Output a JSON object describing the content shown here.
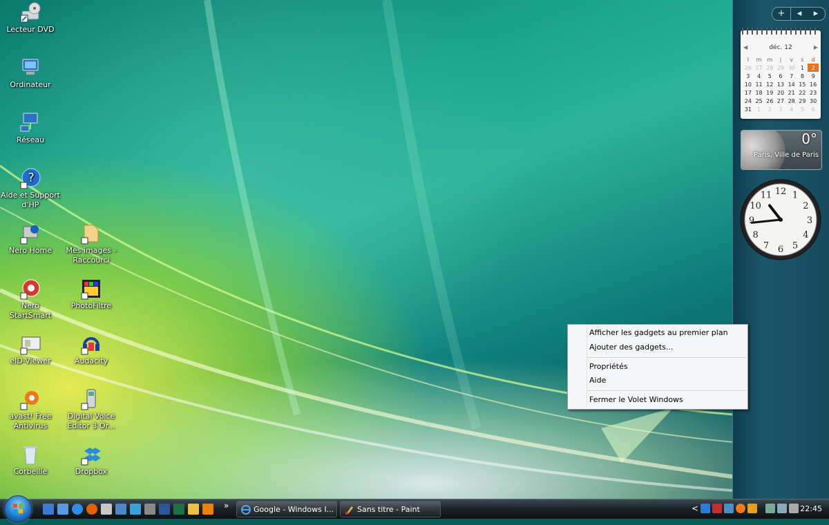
{
  "desktop": {
    "icons": [
      {
        "label": "Lecteur DVD"
      },
      {
        "label": "Ordinateur"
      },
      {
        "label": "Réseau"
      },
      {
        "label": "Aide et Support d'HP"
      },
      {
        "label": "Nero Home"
      },
      {
        "label": "Nero StartSmart"
      },
      {
        "label": "eID-Viewer"
      },
      {
        "label": "avast! Free Antivirus"
      },
      {
        "label": "Corbeille"
      },
      {
        "label": "Mes images - Raccourci"
      },
      {
        "label": "PhotoFiltre"
      },
      {
        "label": "Audacity"
      },
      {
        "label": "Digital Voice Editor 3 Or..."
      },
      {
        "label": "Dropbox"
      }
    ]
  },
  "sidebar": {
    "add_label": "+",
    "prev_label": "◂",
    "next_label": "▸",
    "calendar": {
      "month": "déc. 12",
      "prev": "◀",
      "next": "▶",
      "weekdays": [
        "l",
        "m",
        "m",
        "j",
        "v",
        "s",
        "d"
      ],
      "weeks": [
        [
          "26",
          "27",
          "28",
          "29",
          "30",
          "1",
          "2"
        ],
        [
          "3",
          "4",
          "5",
          "6",
          "7",
          "8",
          "9"
        ],
        [
          "10",
          "11",
          "12",
          "13",
          "14",
          "15",
          "16"
        ],
        [
          "17",
          "18",
          "19",
          "20",
          "21",
          "22",
          "23"
        ],
        [
          "24",
          "25",
          "26",
          "27",
          "28",
          "29",
          "30"
        ],
        [
          "31",
          "1",
          "2",
          "3",
          "4",
          "5",
          "6"
        ]
      ],
      "today": "2"
    },
    "weather": {
      "temperature": "0°",
      "location": "Paris, Ville de Paris"
    },
    "clock": {
      "hours": 10,
      "minutes": 44,
      "numbers": [
        "12",
        "1",
        "2",
        "3",
        "4",
        "5",
        "6",
        "7",
        "8",
        "9",
        "10",
        "11"
      ]
    }
  },
  "context_menu": {
    "items": [
      "Afficher les gadgets au premier plan",
      "Ajouter des gadgets...",
      "Propriétés",
      "Aide",
      "Fermer le Volet Windows"
    ]
  },
  "taskbar": {
    "more_label": "»",
    "tasks": [
      {
        "label": "Google - Windows I..."
      },
      {
        "label": "Sans titre - Paint"
      }
    ],
    "tray_arrow": "<",
    "time": "22:45"
  },
  "colors": {
    "today_highlight": "#e8741c",
    "start_orb": "#1e76c4"
  }
}
